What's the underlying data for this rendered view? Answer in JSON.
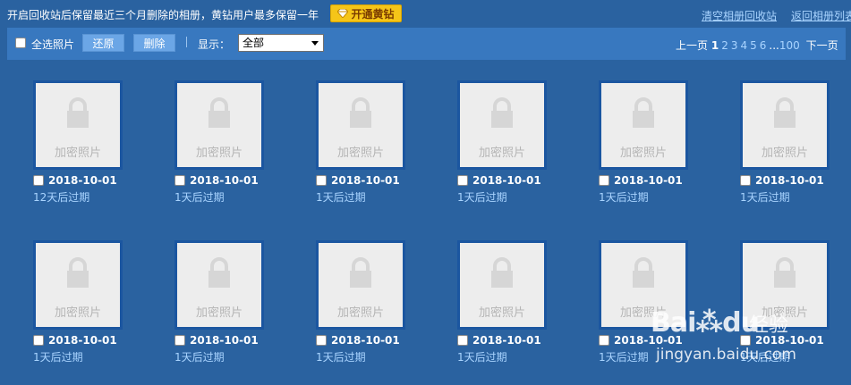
{
  "header": {
    "notice": "开启回收站后保留最近三个月删除的相册，黄钻用户最多保留一年",
    "vip_button": "开通黄钻",
    "clear_link": "清空相册回收站",
    "back_link": "返回相册列表"
  },
  "toolbar": {
    "select_all_label": "全选照片",
    "restore_label": "还原",
    "delete_label": "删除",
    "show_label": "显示：",
    "filter_value": "全部"
  },
  "pager": {
    "prev": "上一页",
    "current": "1",
    "pages": [
      "2",
      "3",
      "4",
      "5",
      "6"
    ],
    "ellipsis": "...",
    "last": "100",
    "next": "下一页"
  },
  "photos": [
    {
      "thumb": "加密照片",
      "date": "2018-10-01",
      "expire": "12天后过期"
    },
    {
      "thumb": "加密照片",
      "date": "2018-10-01",
      "expire": "1天后过期"
    },
    {
      "thumb": "加密照片",
      "date": "2018-10-01",
      "expire": "1天后过期"
    },
    {
      "thumb": "加密照片",
      "date": "2018-10-01",
      "expire": "1天后过期"
    },
    {
      "thumb": "加密照片",
      "date": "2018-10-01",
      "expire": "1天后过期"
    },
    {
      "thumb": "加密照片",
      "date": "2018-10-01",
      "expire": "1天后过期"
    },
    {
      "thumb": "加密照片",
      "date": "2018-10-01",
      "expire": "1天后过期"
    },
    {
      "thumb": "加密照片",
      "date": "2018-10-01",
      "expire": "1天后过期"
    },
    {
      "thumb": "加密照片",
      "date": "2018-10-01",
      "expire": "1天后过期"
    },
    {
      "thumb": "加密照片",
      "date": "2018-10-01",
      "expire": "1天后过期"
    },
    {
      "thumb": "加密照片",
      "date": "2018-10-01",
      "expire": "1天后过期"
    },
    {
      "thumb": "加密照片",
      "date": "2018-10-01",
      "expire": "1天后过期"
    }
  ],
  "watermark": {
    "brand": "Baidu",
    "cn": "经验",
    "url": "jingyan.baidu.com"
  },
  "colors": {
    "background": "#2a62a0",
    "toolbar": "#3878bf",
    "button": "#6ba6e6",
    "link": "#a9d4ff",
    "vip": "#f5c518"
  }
}
